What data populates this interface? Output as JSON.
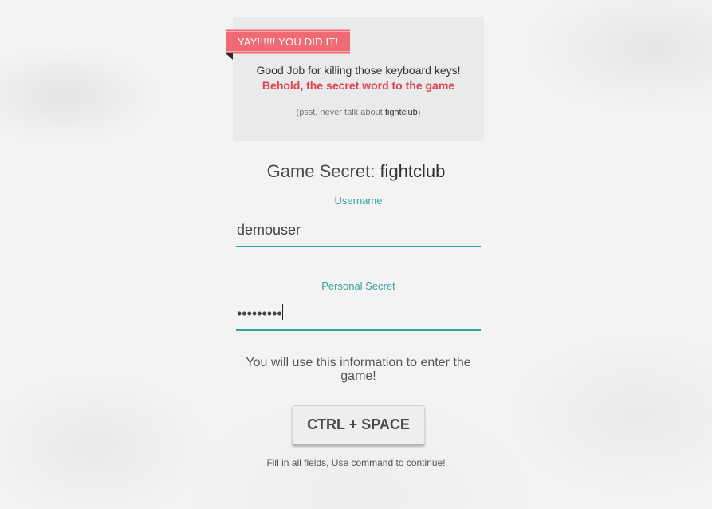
{
  "notice": {
    "ribbon": "YAY!!!!!! YOU DID IT!",
    "message": "Good Job for killing those keyboard keys!",
    "highlight": "Behold, the secret word to the game",
    "hint_prefix": "(psst, never talk about ",
    "hint_word": "fightclub",
    "hint_suffix": ")"
  },
  "game_secret": {
    "label": "Game Secret: ",
    "value": "fightclub"
  },
  "form": {
    "username_label": "Username",
    "username_value": "demouser",
    "secret_label": "Personal Secret",
    "secret_masked": "•••••••••",
    "info": "You will use this information to enter the game!"
  },
  "action": {
    "button_label": "CTRL + SPACE",
    "footer": "Fill in all fields, Use command to continue!"
  },
  "colors": {
    "accent_teal": "#34a3a8",
    "ribbon_red": "#ef6a73",
    "highlight_red": "#e0404c"
  }
}
